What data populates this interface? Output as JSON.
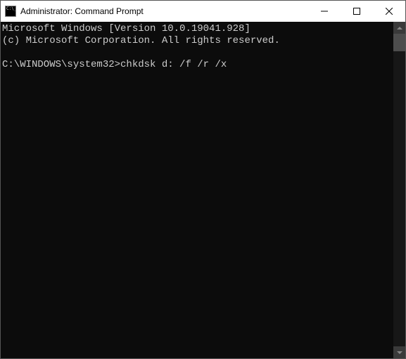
{
  "titlebar": {
    "title": "Administrator: Command Prompt"
  },
  "console": {
    "line1": "Microsoft Windows [Version 10.0.19041.928]",
    "line2": "(c) Microsoft Corporation. All rights reserved.",
    "blank": "",
    "prompt": "C:\\WINDOWS\\system32>",
    "command": "chkdsk d: /f /r /x"
  }
}
